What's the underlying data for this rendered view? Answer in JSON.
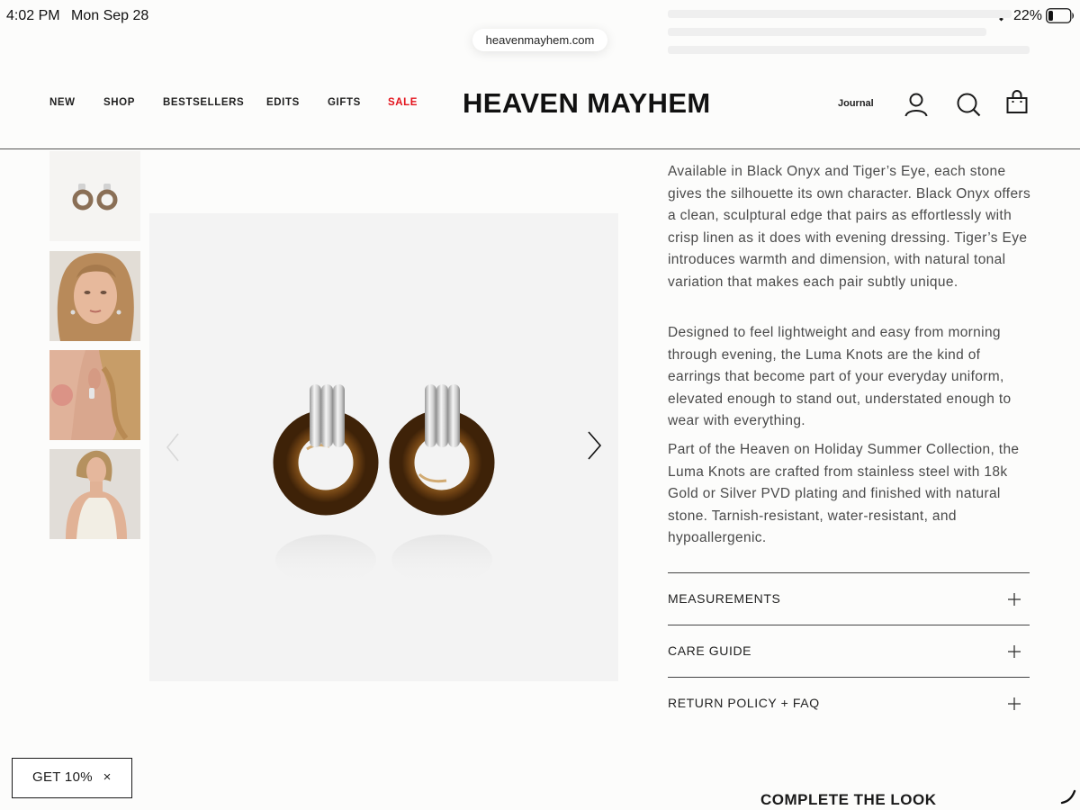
{
  "status_bar": {
    "time": "4:02 PM",
    "date": "Mon Sep 28",
    "battery_percent": "22%",
    "battery_level": 0.22
  },
  "browser": {
    "url": "heavenmayhem.com"
  },
  "header": {
    "nav": [
      "NEW",
      "SHOP",
      "BESTSELLERS",
      "EDITS",
      "GIFTS",
      "SALE"
    ],
    "logo": "HEAVEN MAYHEM",
    "journal": "Journal",
    "icons": [
      "account-icon",
      "search-icon",
      "bag-icon"
    ],
    "sale_color": "#e3121b"
  },
  "gallery": {
    "thumbnails": [
      "earrings-product-shot",
      "model-front-portrait",
      "model-ear-closeup",
      "model-side-full"
    ],
    "main_image": "tiger-eye-earrings",
    "arrows": [
      "chevron-left-icon",
      "chevron-right-icon"
    ]
  },
  "description": {
    "paragraphs": [
      "Available in Black Onyx and Tiger’s Eye, each stone gives the silhouette its own character. Black Onyx offers a clean, sculptural edge that pairs as effortlessly with crisp linen as it does with evening dressing. Tiger’s Eye introduces warmth and dimension, with natural tonal variation that makes each pair subtly unique.",
      "Designed to feel lightweight and easy from morning through evening, the Luma Knots are the kind of earrings that become part of your everyday uniform, elevated enough to stand out, understated enough to wear with everything.",
      "Part of the Heaven on Holiday Summer Collection, the Luma Knots are crafted from stainless steel with 18k Gold or Silver PVD plating and finished with natural stone. Tarnish-resistant, water-resistant, and hypoallergenic."
    ]
  },
  "accordion": [
    {
      "label": "MEASUREMENTS"
    },
    {
      "label": "CARE GUIDE"
    },
    {
      "label": "RETURN POLICY + FAQ"
    }
  ],
  "complete_the_look": "COMPLETE THE LOOK",
  "promo": {
    "label": "GET 10%",
    "close": "×"
  }
}
